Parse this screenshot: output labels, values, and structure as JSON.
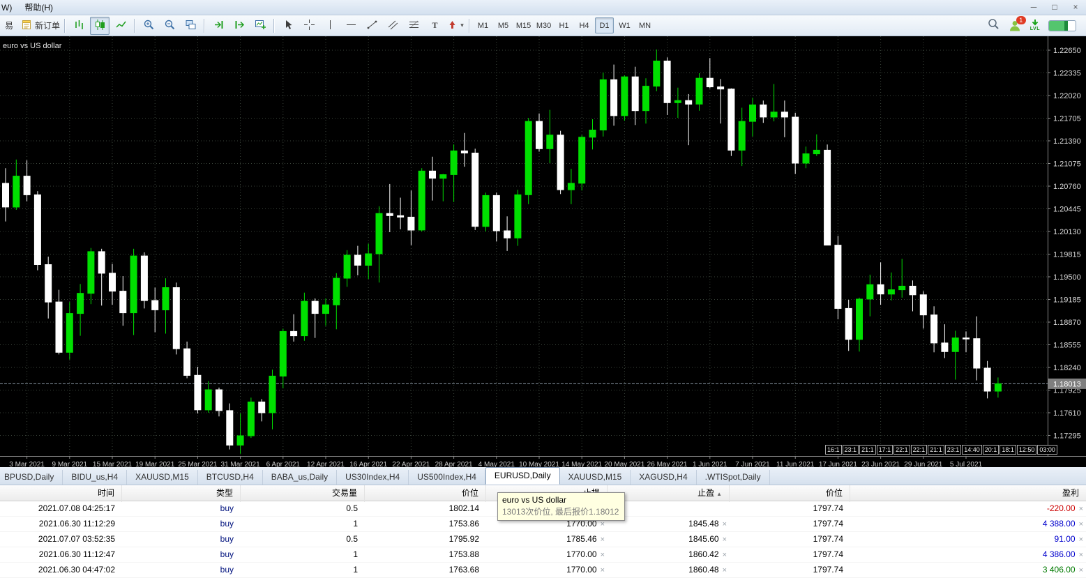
{
  "window": {
    "menu_partial": "W)",
    "menu_help": "帮助(H)",
    "controls": {
      "minimize": "─",
      "restore": "□",
      "close": "×"
    }
  },
  "toolbar": {
    "partial_button": "易",
    "groups": [
      {
        "items": [
          {
            "icon": "new-order",
            "label": "新订单"
          }
        ]
      },
      {
        "items": [
          {
            "icon": "bar-chart"
          },
          {
            "icon": "candle-chart",
            "active": true
          },
          {
            "icon": "line-chart"
          }
        ]
      },
      {
        "items": [
          {
            "icon": "zoom-in"
          },
          {
            "icon": "zoom-out"
          },
          {
            "icon": "tile-windows"
          }
        ]
      },
      {
        "items": [
          {
            "icon": "auto-scroll"
          },
          {
            "icon": "chart-shift"
          },
          {
            "icon": "indicators"
          }
        ]
      },
      {
        "items": [
          {
            "icon": "cursor"
          },
          {
            "icon": "crosshair"
          },
          {
            "icon": "vertical-line"
          },
          {
            "icon": "horizontal-line"
          },
          {
            "icon": "trendline"
          },
          {
            "icon": "channel"
          },
          {
            "icon": "fibonacci"
          },
          {
            "icon": "text-label"
          },
          {
            "icon": "arrow-symbols",
            "dropdown": true
          }
        ]
      }
    ],
    "timeframes": [
      "M1",
      "M5",
      "M15",
      "M30",
      "H1",
      "H4",
      "D1",
      "W1",
      "MN"
    ],
    "active_timeframe": "D1",
    "right": {
      "badge": "1",
      "lvl_label": "LVL"
    }
  },
  "chart": {
    "symbol_label": "euro vs US dollar",
    "current_price_label": "1.18013",
    "price_ticks": [
      "1.22650",
      "1.22335",
      "1.22020",
      "1.21705",
      "1.21390",
      "1.21075",
      "1.20760",
      "1.20445",
      "1.20130",
      "1.19815",
      "1.19500",
      "1.19185",
      "1.18870",
      "1.18555",
      "1.18240",
      "1.17925",
      "1.17610",
      "1.17295"
    ],
    "time_boxes": [
      "16:1",
      "23:1",
      "21:1",
      "17:1",
      "22:1",
      "22:1",
      "21:1",
      "23:1",
      "14:40",
      "20:1",
      "18:1",
      "12:50",
      "03:00"
    ],
    "colors": {
      "background": "#000000",
      "grid": "#3c463c",
      "bull": "#00e000",
      "bear": "#ffffff",
      "bid_line": "#8a97a5",
      "axis_text": "#dcdcdc",
      "date_text": "#c8c8c8",
      "current_tag_bg": "#7f7f7f"
    }
  },
  "chart_data": {
    "type": "candlestick",
    "title": "euro vs US dollar",
    "symbol": "EURUSD",
    "timeframe": "Daily",
    "current_price": 1.18013,
    "ylim": [
      1.17295,
      1.2265
    ],
    "y_ticks": [
      1.2265,
      1.22335,
      1.2202,
      1.21705,
      1.2139,
      1.21075,
      1.2076,
      1.20445,
      1.2013,
      1.19815,
      1.195,
      1.19185,
      1.1887,
      1.18555,
      1.1824,
      1.17925,
      1.1761,
      1.17295
    ],
    "x_tick_labels": [
      {
        "i": 2,
        "t": "3 Mar 2021"
      },
      {
        "i": 6,
        "t": "9 Mar 2021"
      },
      {
        "i": 10,
        "t": "15 Mar 2021"
      },
      {
        "i": 14,
        "t": "19 Mar 2021"
      },
      {
        "i": 18,
        "t": "25 Mar 2021"
      },
      {
        "i": 22,
        "t": "31 Mar 2021"
      },
      {
        "i": 26,
        "t": "6 Apr 2021"
      },
      {
        "i": 30,
        "t": "12 Apr 2021"
      },
      {
        "i": 34,
        "t": "16 Apr 2021"
      },
      {
        "i": 38,
        "t": "22 Apr 2021"
      },
      {
        "i": 42,
        "t": "28 Apr 2021"
      },
      {
        "i": 46,
        "t": "4 May 2021"
      },
      {
        "i": 50,
        "t": "10 May 2021"
      },
      {
        "i": 54,
        "t": "14 May 2021"
      },
      {
        "i": 58,
        "t": "20 May 2021"
      },
      {
        "i": 62,
        "t": "26 May 2021"
      },
      {
        "i": 66,
        "t": "1 Jun 2021"
      },
      {
        "i": 70,
        "t": "7 Jun 2021"
      },
      {
        "i": 74,
        "t": "11 Jun 2021"
      },
      {
        "i": 78,
        "t": "17 Jun 2021"
      },
      {
        "i": 82,
        "t": "23 Jun 2021"
      },
      {
        "i": 86,
        "t": "29 Jun 2021"
      },
      {
        "i": 90,
        "t": "5 Jul 2021"
      }
    ],
    "dates": [
      "2021-03-01",
      "2021-03-02",
      "2021-03-03",
      "2021-03-04",
      "2021-03-05",
      "2021-03-08",
      "2021-03-09",
      "2021-03-10",
      "2021-03-11",
      "2021-03-12",
      "2021-03-15",
      "2021-03-16",
      "2021-03-17",
      "2021-03-18",
      "2021-03-19",
      "2021-03-22",
      "2021-03-23",
      "2021-03-24",
      "2021-03-25",
      "2021-03-26",
      "2021-03-29",
      "2021-03-30",
      "2021-03-31",
      "2021-04-01",
      "2021-04-02",
      "2021-04-05",
      "2021-04-06",
      "2021-04-07",
      "2021-04-08",
      "2021-04-09",
      "2021-04-12",
      "2021-04-13",
      "2021-04-14",
      "2021-04-15",
      "2021-04-16",
      "2021-04-19",
      "2021-04-20",
      "2021-04-21",
      "2021-04-22",
      "2021-04-23",
      "2021-04-26",
      "2021-04-27",
      "2021-04-28",
      "2021-04-29",
      "2021-04-30",
      "2021-05-03",
      "2021-05-04",
      "2021-05-05",
      "2021-05-06",
      "2021-05-07",
      "2021-05-10",
      "2021-05-11",
      "2021-05-12",
      "2021-05-13",
      "2021-05-14",
      "2021-05-17",
      "2021-05-18",
      "2021-05-19",
      "2021-05-20",
      "2021-05-21",
      "2021-05-24",
      "2021-05-25",
      "2021-05-26",
      "2021-05-27",
      "2021-05-28",
      "2021-05-31",
      "2021-06-01",
      "2021-06-02",
      "2021-06-03",
      "2021-06-04",
      "2021-06-07",
      "2021-06-08",
      "2021-06-09",
      "2021-06-10",
      "2021-06-11",
      "2021-06-14",
      "2021-06-15",
      "2021-06-16",
      "2021-06-17",
      "2021-06-18",
      "2021-06-21",
      "2021-06-22",
      "2021-06-23",
      "2021-06-24",
      "2021-06-25",
      "2021-06-28",
      "2021-06-29",
      "2021-06-30",
      "2021-07-01",
      "2021-07-02",
      "2021-07-05",
      "2021-07-06",
      "2021-07-07",
      "2021-07-08"
    ],
    "ohlc": [
      [
        1.208,
        1.2101,
        1.2027,
        1.2047
      ],
      [
        1.2047,
        1.2113,
        1.2043,
        1.209
      ],
      [
        1.209,
        1.2112,
        1.2055,
        1.2064
      ],
      [
        1.2064,
        1.2069,
        1.1959,
        1.1967
      ],
      [
        1.1967,
        1.1978,
        1.1892,
        1.1915
      ],
      [
        1.1915,
        1.1932,
        1.1842,
        1.1845
      ],
      [
        1.1845,
        1.1915,
        1.1835,
        1.1899
      ],
      [
        1.1899,
        1.194,
        1.1868,
        1.1927
      ],
      [
        1.1927,
        1.199,
        1.1912,
        1.1985
      ],
      [
        1.1985,
        1.1989,
        1.191,
        1.1955
      ],
      [
        1.1955,
        1.1968,
        1.1911,
        1.193
      ],
      [
        1.193,
        1.1951,
        1.1882,
        1.19
      ],
      [
        1.19,
        1.1989,
        1.1869,
        1.1979
      ],
      [
        1.1979,
        1.1984,
        1.1906,
        1.1917
      ],
      [
        1.1917,
        1.1935,
        1.1873,
        1.1904
      ],
      [
        1.1904,
        1.1948,
        1.1871,
        1.1935
      ],
      [
        1.1935,
        1.1942,
        1.1842,
        1.185
      ],
      [
        1.185,
        1.186,
        1.1809,
        1.1813
      ],
      [
        1.1813,
        1.1825,
        1.176,
        1.1765
      ],
      [
        1.1765,
        1.1805,
        1.1761,
        1.1793
      ],
      [
        1.1793,
        1.1796,
        1.1756,
        1.1764
      ],
      [
        1.1764,
        1.1774,
        1.171,
        1.1716
      ],
      [
        1.1716,
        1.176,
        1.1704,
        1.1729
      ],
      [
        1.1729,
        1.1782,
        1.1726,
        1.1776
      ],
      [
        1.1776,
        1.178,
        1.1749,
        1.1761
      ],
      [
        1.1761,
        1.1821,
        1.1738,
        1.1812
      ],
      [
        1.1812,
        1.1878,
        1.1795,
        1.1874
      ],
      [
        1.1874,
        1.1898,
        1.186,
        1.1868
      ],
      [
        1.1868,
        1.1928,
        1.1861,
        1.1916
      ],
      [
        1.1916,
        1.192,
        1.1865,
        1.1899
      ],
      [
        1.1899,
        1.192,
        1.1882,
        1.1911
      ],
      [
        1.1911,
        1.1955,
        1.1877,
        1.1948
      ],
      [
        1.1948,
        1.1987,
        1.1936,
        1.198
      ],
      [
        1.198,
        1.1993,
        1.1952,
        1.1966
      ],
      [
        1.1966,
        1.1996,
        1.1947,
        1.1982
      ],
      [
        1.1982,
        1.2048,
        1.1942,
        1.2038
      ],
      [
        1.2038,
        1.2079,
        1.2012,
        1.2035
      ],
      [
        1.2035,
        1.206,
        1.2016,
        1.2033
      ],
      [
        1.2033,
        1.207,
        1.1994,
        1.2015
      ],
      [
        1.2015,
        1.2101,
        1.2013,
        1.2097
      ],
      [
        1.2097,
        1.2117,
        1.2056,
        1.2087
      ],
      [
        1.2087,
        1.2093,
        1.2055,
        1.2092
      ],
      [
        1.2092,
        1.2134,
        1.2054,
        1.2125
      ],
      [
        1.2125,
        1.215,
        1.2103,
        1.2122
      ],
      [
        1.2122,
        1.2128,
        1.2015,
        1.202
      ],
      [
        1.202,
        1.2067,
        1.2013,
        1.2063
      ],
      [
        1.2063,
        1.2067,
        1.1999,
        1.2014
      ],
      [
        1.2014,
        1.2034,
        1.1986,
        1.2004
      ],
      [
        1.2004,
        1.2071,
        1.1993,
        1.2064
      ],
      [
        1.2064,
        1.2171,
        1.2051,
        1.2166
      ],
      [
        1.2166,
        1.2177,
        1.2124,
        1.2128
      ],
      [
        1.2128,
        1.2182,
        1.2108,
        1.2147
      ],
      [
        1.2147,
        1.2153,
        1.2065,
        1.2071
      ],
      [
        1.2071,
        1.21,
        1.2051,
        1.208
      ],
      [
        1.208,
        1.2147,
        1.207,
        1.2144
      ],
      [
        1.2144,
        1.2169,
        1.2127,
        1.2154
      ],
      [
        1.2154,
        1.2234,
        1.2145,
        1.2224
      ],
      [
        1.2224,
        1.2245,
        1.216,
        1.2174
      ],
      [
        1.2174,
        1.223,
        1.2167,
        1.2228
      ],
      [
        1.2228,
        1.2242,
        1.2161,
        1.2181
      ],
      [
        1.2181,
        1.2226,
        1.2163,
        1.2215
      ],
      [
        1.2215,
        1.2266,
        1.2208,
        1.225
      ],
      [
        1.225,
        1.2255,
        1.2175,
        1.2192
      ],
      [
        1.2192,
        1.2213,
        1.2171,
        1.2195
      ],
      [
        1.2195,
        1.2204,
        1.2133,
        1.219
      ],
      [
        1.219,
        1.2233,
        1.2181,
        1.2226
      ],
      [
        1.2226,
        1.2254,
        1.2212,
        1.2214
      ],
      [
        1.2214,
        1.2225,
        1.2163,
        1.2211
      ],
      [
        1.2211,
        1.2212,
        1.2118,
        1.2126
      ],
      [
        1.2126,
        1.2185,
        1.2104,
        1.2166
      ],
      [
        1.2166,
        1.2199,
        1.2145,
        1.2189
      ],
      [
        1.2189,
        1.2195,
        1.2164,
        1.2172
      ],
      [
        1.2172,
        1.2218,
        1.2166,
        1.2179
      ],
      [
        1.2179,
        1.2195,
        1.2144,
        1.2172
      ],
      [
        1.2172,
        1.2178,
        1.2093,
        1.2108
      ],
      [
        1.2108,
        1.2131,
        1.2101,
        1.2121
      ],
      [
        1.2121,
        1.2148,
        1.2118,
        1.2126
      ],
      [
        1.2126,
        1.2134,
        1.1994,
        1.1994
      ],
      [
        1.1994,
        1.2007,
        1.1891,
        1.1906
      ],
      [
        1.1906,
        1.1918,
        1.1847,
        1.1863
      ],
      [
        1.1863,
        1.1921,
        1.1846,
        1.1919
      ],
      [
        1.1919,
        1.1953,
        1.1895,
        1.1939
      ],
      [
        1.1939,
        1.197,
        1.1911,
        1.1926
      ],
      [
        1.1926,
        1.1956,
        1.1917,
        1.1932
      ],
      [
        1.1932,
        1.1975,
        1.1921,
        1.1937
      ],
      [
        1.1937,
        1.1945,
        1.1902,
        1.1925
      ],
      [
        1.1925,
        1.193,
        1.1878,
        1.1897
      ],
      [
        1.1897,
        1.1909,
        1.1845,
        1.1858
      ],
      [
        1.1858,
        1.1884,
        1.1837,
        1.1846
      ],
      [
        1.1846,
        1.1875,
        1.1807,
        1.1865
      ],
      [
        1.1865,
        1.1874,
        1.1845,
        1.1864
      ],
      [
        1.1864,
        1.1895,
        1.1806,
        1.1823
      ],
      [
        1.1823,
        1.1833,
        1.1781,
        1.1791
      ],
      [
        1.1791,
        1.181,
        1.1782,
        1.18013
      ]
    ]
  },
  "tabs": [
    {
      "label": "BPUSD,Daily",
      "cut": true
    },
    {
      "label": "BIDU_us,H4"
    },
    {
      "label": "XAUUSD,M15"
    },
    {
      "label": "BTCUSD,H4"
    },
    {
      "label": "BABA_us,Daily"
    },
    {
      "label": "US30Index,H4"
    },
    {
      "label": "US500Index,H4"
    },
    {
      "label": "EURUSD,Daily",
      "active": true
    },
    {
      "label": "XAUUSD,M15"
    },
    {
      "label": "XAGUSD,H4"
    },
    {
      "label": ".WTISpot,Daily"
    }
  ],
  "terminal": {
    "headers": {
      "time": "时间",
      "type": "类型",
      "volume": "交易量",
      "price": "价位",
      "sl": "止损",
      "tp": "止盈",
      "price2": "价位",
      "profit": "盈利"
    },
    "sort_arrow": "▲",
    "close_glyph": "×",
    "rows": [
      {
        "time": "2021.07.08 04:25:17",
        "type": "buy",
        "volume": "0.5",
        "price": "1802.14",
        "sl": "",
        "tp": "",
        "price2": "1797.74",
        "profit": "-220.00",
        "profit_color": "red"
      },
      {
        "time": "2021.06.30 11:12:29",
        "type": "buy",
        "volume": "1",
        "price": "1753.86",
        "sl": "1770.00",
        "tp": "1845.48",
        "price2": "1797.74",
        "profit": "4 388.00",
        "profit_color": "blue"
      },
      {
        "time": "2021.07.07 03:52:35",
        "type": "buy",
        "volume": "0.5",
        "price": "1795.92",
        "sl": "1785.46",
        "tp": "1845.60",
        "price2": "1797.74",
        "profit": "91.00",
        "profit_color": "blue"
      },
      {
        "time": "2021.06.30 11:12:47",
        "type": "buy",
        "volume": "1",
        "price": "1753.88",
        "sl": "1770.00",
        "tp": "1860.42",
        "price2": "1797.74",
        "profit": "4 386.00",
        "profit_color": "blue"
      },
      {
        "time": "2021.06.30 04:47:02",
        "type": "buy",
        "volume": "1",
        "price": "1763.68",
        "sl": "1770.00",
        "tp": "1860.48",
        "price2": "1797.74",
        "profit": "3 406.00",
        "profit_color": "green"
      }
    ]
  },
  "tooltip": {
    "line1": "euro vs US dollar",
    "line2": "13013次价位, 最后报价1.18012"
  }
}
